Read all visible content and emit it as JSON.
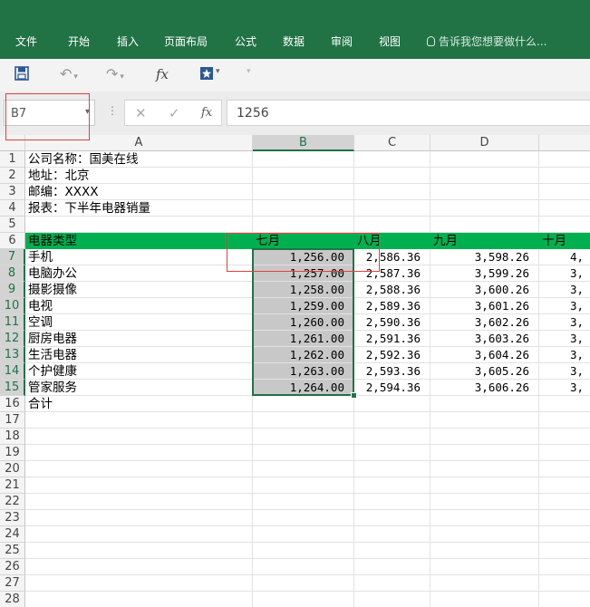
{
  "ribbon": {
    "tabs": [
      "文件",
      "开始",
      "插入",
      "页面布局",
      "公式",
      "数据",
      "审阅",
      "视图"
    ],
    "tell_me": "告诉我您想要做什么..."
  },
  "quick_access": {
    "save_icon": "save-icon",
    "undo_icon": "undo-icon",
    "redo_icon": "redo-icon",
    "fx_label": "fx",
    "customize_icon": "quick-access-customize-icon"
  },
  "formula_bar": {
    "name_box": "B7",
    "cancel_icon": "cancel-icon",
    "enter_icon": "enter-icon",
    "fx_label": "fx",
    "value": "1256"
  },
  "sheet": {
    "columns": [
      "A",
      "B",
      "C",
      "D",
      ""
    ],
    "rows": [
      "1",
      "2",
      "3",
      "4",
      "5",
      "6",
      "7",
      "8",
      "9",
      "10",
      "11",
      "12",
      "13",
      "14",
      "15",
      "16",
      "17",
      "18",
      "19",
      "20",
      "21",
      "22",
      "23",
      "24",
      "25",
      "26",
      "27",
      "28"
    ],
    "info": [
      "公司名称：国美在线",
      "地址：北京",
      "邮编：XXXX",
      "报表：下半年电器销量"
    ],
    "header_row": [
      "电器类型",
      "七月",
      "八月",
      "九月",
      "十月"
    ],
    "data_rows": [
      [
        "手机",
        "1,256.00",
        "2,586.36",
        "3,598.26",
        "4,"
      ],
      [
        "电脑办公",
        "1,257.00",
        "2,587.36",
        "3,599.26",
        "3,"
      ],
      [
        "摄影摄像",
        "1,258.00",
        "2,588.36",
        "3,600.26",
        "3,"
      ],
      [
        "电视",
        "1,259.00",
        "2,589.36",
        "3,601.26",
        "3,"
      ],
      [
        "空调",
        "1,260.00",
        "2,590.36",
        "3,602.26",
        "3,"
      ],
      [
        "厨房电器",
        "1,261.00",
        "2,591.36",
        "3,603.26",
        "3,"
      ],
      [
        "生活电器",
        "1,262.00",
        "2,592.36",
        "3,604.26",
        "3,"
      ],
      [
        "个护健康",
        "1,263.00",
        "2,593.36",
        "3,605.26",
        "3,"
      ],
      [
        "管家服务",
        "1,264.00",
        "2,594.36",
        "3,606.26",
        "3,"
      ]
    ],
    "total_label": "合计",
    "selected_range": "B7:B15",
    "header_fill": "#00b050",
    "accent": "#217346"
  }
}
